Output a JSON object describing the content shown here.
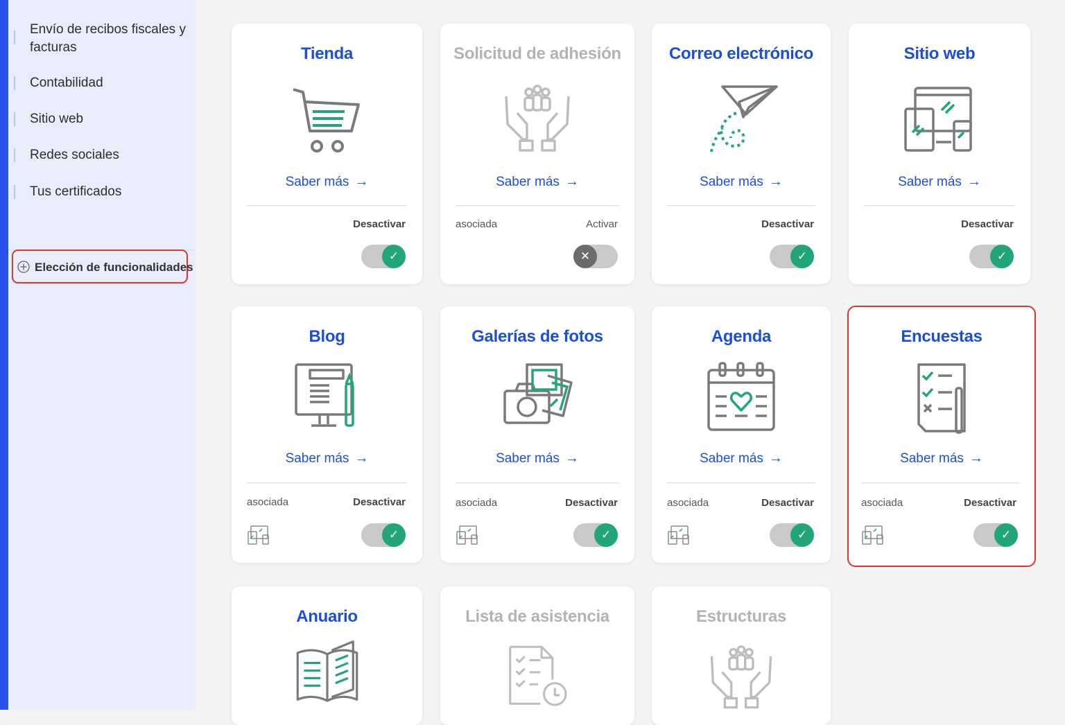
{
  "sidebar": {
    "items": [
      {
        "label": "Envío de recibos fiscales y facturas"
      },
      {
        "label": "Contabilidad"
      },
      {
        "label": "Sitio web"
      },
      {
        "label": "Redes sociales"
      },
      {
        "label": "Tus certificados"
      }
    ],
    "selected": {
      "label": "Elección de funcionalidades",
      "icon": "plus-circle-icon"
    }
  },
  "cards": [
    {
      "title": "Tienda",
      "icon": "shopping-cart-icon",
      "learn_more": "Saber más",
      "assoc": "",
      "action": "Desactivar",
      "enabled": true
    },
    {
      "title": "Solicitud de adhesión",
      "icon": "hands-people-icon",
      "learn_more": "Saber más",
      "assoc": "asociada",
      "action": "Activar",
      "enabled": false
    },
    {
      "title": "Correo electrónico",
      "icon": "paper-plane-icon",
      "learn_more": "Saber más",
      "assoc": "",
      "action": "Desactivar",
      "enabled": true
    },
    {
      "title": "Sitio web",
      "icon": "devices-icon",
      "learn_more": "Saber más",
      "assoc": "",
      "action": "Desactivar",
      "enabled": true
    },
    {
      "title": "Blog",
      "icon": "blog-monitor-icon",
      "learn_more": "Saber más",
      "assoc": "asociada",
      "action": "Desactivar",
      "enabled": true
    },
    {
      "title": "Galerías de fotos",
      "icon": "camera-photos-icon",
      "learn_more": "Saber más",
      "assoc": "asociada",
      "action": "Desactivar",
      "enabled": true
    },
    {
      "title": "Agenda",
      "icon": "calendar-heart-icon",
      "learn_more": "Saber más",
      "assoc": "asociada",
      "action": "Desactivar",
      "enabled": true
    },
    {
      "title": "Encuestas",
      "icon": "survey-checklist-icon",
      "learn_more": "Saber más",
      "assoc": "asociada",
      "action": "Desactivar",
      "enabled": true
    },
    {
      "title": "Anuario",
      "icon": "open-book-icon"
    },
    {
      "title": "Lista de asistencia",
      "icon": "attendance-list-icon"
    },
    {
      "title": "Estructuras",
      "icon": "hands-people-icon"
    }
  ],
  "colors": {
    "accent": "#1d4fd6",
    "toggle_on": "#22a57a",
    "highlight": "#e0342a",
    "disabled_text": "#b3b3b3"
  }
}
